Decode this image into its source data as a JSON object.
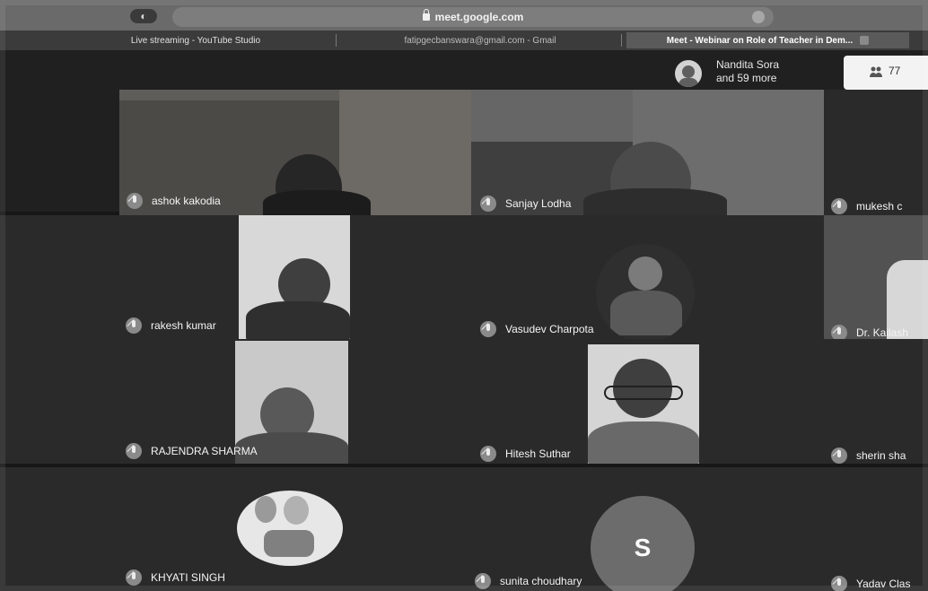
{
  "browser": {
    "url": "meet.google.com",
    "tabs": [
      {
        "label": "Live streaming - YouTube Studio"
      },
      {
        "label": "fatipgecbanswara@gmail.com - Gmail"
      },
      {
        "label": "Meet - Webinar on Role of Teacher in Dem..."
      }
    ]
  },
  "participants_summary": {
    "line1": "Nandita Sora",
    "line2": "and 59 more",
    "count": "77"
  },
  "tiles": [
    {
      "name": "ashok kakodia"
    },
    {
      "name": "Sanjay Lodha"
    },
    {
      "name": "mukesh c"
    },
    {
      "name": "rakesh kumar"
    },
    {
      "name": "Vasudev Charpota"
    },
    {
      "name": "Dr. Kailash"
    },
    {
      "name": "RAJENDRA SHARMA"
    },
    {
      "name": "Hitesh Suthar"
    },
    {
      "name": "sherin sha"
    },
    {
      "name": "KHYATI SINGH"
    },
    {
      "name": "sunita choudhary",
      "initial": "S"
    },
    {
      "name": "Yadav Clas"
    }
  ]
}
